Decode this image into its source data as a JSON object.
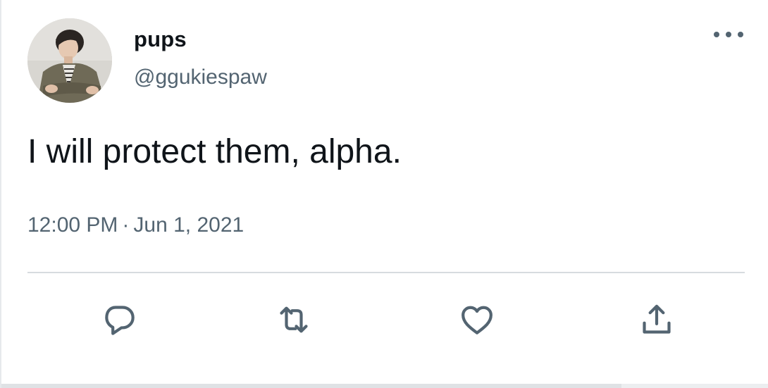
{
  "tweet": {
    "display_name": "pups",
    "handle": "@ggukiespaw",
    "text": "I will protect them, alpha.",
    "time": "12:00 PM",
    "separator": "·",
    "date": "Jun 1, 2021"
  },
  "icons": {
    "more": "more-horizontal-icon",
    "reply": "reply-icon",
    "retweet": "retweet-icon",
    "like": "heart-icon",
    "share": "share-icon"
  },
  "colors": {
    "text_primary": "#0f1419",
    "text_secondary": "#536471",
    "icon": "#536471",
    "divider": "#d7dbdf"
  }
}
